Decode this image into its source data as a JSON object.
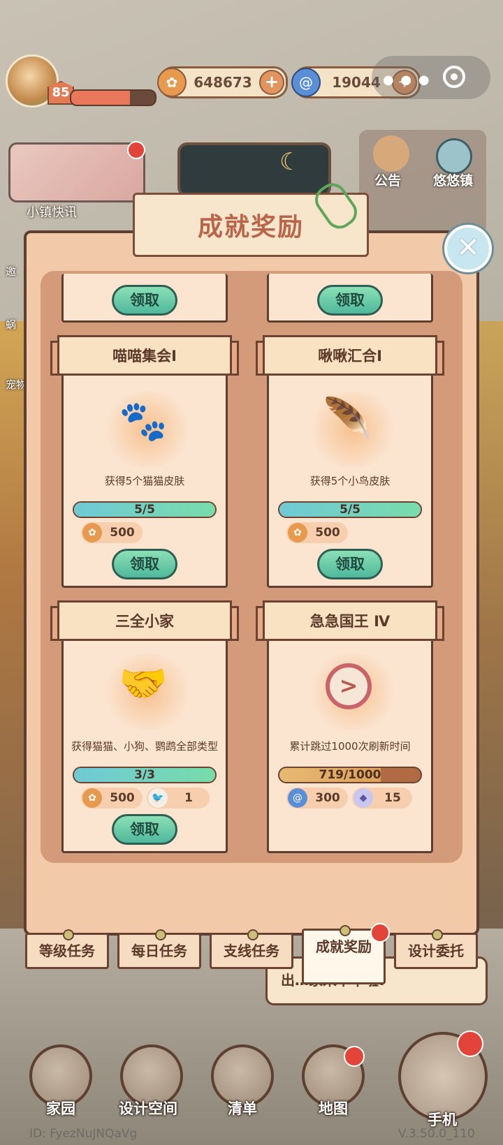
{
  "topbar": {
    "level": "85",
    "coins": "648673",
    "gems": "19044"
  },
  "left": {
    "news_label": "小镇快讯",
    "side_labels": [
      "邀",
      "蜗",
      "宠物"
    ]
  },
  "right": {
    "announce_label": "公告",
    "town_label": "悠悠镇"
  },
  "modal": {
    "title": "成就奖励",
    "claim_label": "领取",
    "cards": [
      {
        "name": "喵喵集会Ⅰ",
        "desc": "获得5个猫猫皮肤",
        "progress": "5/5",
        "progress_frac": 1.0,
        "rewards": [
          {
            "icon": "coin-icon",
            "value": "500"
          }
        ]
      },
      {
        "name": "啾啾汇合Ⅰ",
        "desc": "获得5个小鸟皮肤",
        "progress": "5/5",
        "progress_frac": 1.0,
        "rewards": [
          {
            "icon": "coin-icon",
            "value": "500"
          }
        ]
      },
      {
        "name": "三全小家",
        "desc": "获得猫猫、小狗、鹦鹉全部类型",
        "progress": "3/3",
        "progress_frac": 1.0,
        "rewards": [
          {
            "icon": "coin-icon",
            "value": "500"
          },
          {
            "icon": "parrot-icon",
            "value": "1"
          }
        ]
      },
      {
        "name": "急急国王 Ⅳ",
        "desc": "累计跳过1000次刷新时间",
        "progress": "719/1000",
        "progress_frac": 0.719,
        "rewards": [
          {
            "icon": "gem-icon",
            "value": "300"
          },
          {
            "icon": "ticket-icon",
            "value": "15"
          }
        ]
      }
    ]
  },
  "tabs": [
    {
      "label": "等级任务"
    },
    {
      "label": "每日任务"
    },
    {
      "label": "支线任务"
    },
    {
      "label": "成就奖励"
    },
    {
      "label": "设计委托"
    }
  ],
  "hint": {
    "text": "出…家来下单啦!"
  },
  "bottom_nav": [
    {
      "label": "家园"
    },
    {
      "label": "设计空间"
    },
    {
      "label": "清单"
    },
    {
      "label": "地图"
    },
    {
      "label": "手机"
    }
  ],
  "footer": {
    "user_id": "ID: FyezNuJNQaVg",
    "version": "V.3.50.0_110"
  },
  "colors": {
    "claim_green": "#4fb89b",
    "progress_teal": "#6fd1c0",
    "progress_orange": "#e0a45a",
    "accent_title": "#b9654a"
  }
}
